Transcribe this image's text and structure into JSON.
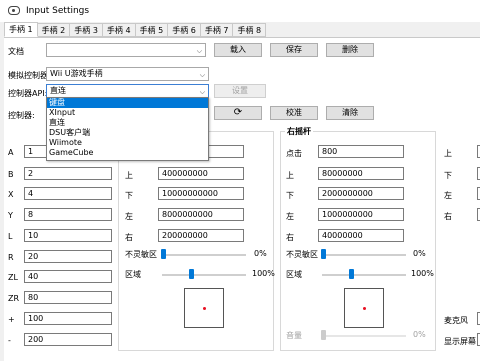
{
  "window": {
    "title": "Input Settings"
  },
  "tabs": [
    "手柄 1",
    "手柄 2",
    "手柄 3",
    "手柄 4",
    "手柄 5",
    "手柄 6",
    "手柄 7",
    "手柄 8"
  ],
  "profile": {
    "label": "文档",
    "value": "",
    "load": "载入",
    "save": "保存",
    "delete": "删除"
  },
  "emulated": {
    "label": "模拟控制器",
    "value": "Wii U游戏手柄"
  },
  "api": {
    "label": "控制器API:",
    "value": "直连",
    "configure": "设置",
    "options": [
      "键盘",
      "XInput",
      "直连",
      "DSU客户端",
      "Wiimote",
      "GameCube"
    ],
    "selected_index": 0
  },
  "controller": {
    "label": "控制器:",
    "calibrate": "校准",
    "clear": "清除"
  },
  "buttons": [
    {
      "label": "A",
      "value": "1"
    },
    {
      "label": "B",
      "value": "2"
    },
    {
      "label": "X",
      "value": "4"
    },
    {
      "label": "Y",
      "value": "8"
    },
    {
      "label": "L",
      "value": "10"
    },
    {
      "label": "R",
      "value": "20"
    },
    {
      "label": "ZL",
      "value": "40"
    },
    {
      "label": "ZR",
      "value": "80"
    },
    {
      "label": "+",
      "value": "100"
    },
    {
      "label": "-",
      "value": "200"
    }
  ],
  "left_stick": {
    "rows": [
      {
        "label": "上",
        "value": "400000000"
      },
      {
        "label": "下",
        "value": "10000000000"
      },
      {
        "label": "左",
        "value": "8000000000"
      },
      {
        "label": "右",
        "value": "200000000"
      }
    ],
    "deadzone_label": "不灵敏区",
    "deadzone_value": "0%",
    "deadzone_level": 0,
    "range_label": "区域",
    "range_value": "100%",
    "range_level": 1
  },
  "right_stick": {
    "title": "右摇杆",
    "rows": [
      {
        "label": "点击",
        "value": "800"
      },
      {
        "label": "上",
        "value": "80000000"
      },
      {
        "label": "下",
        "value": "2000000000"
      },
      {
        "label": "左",
        "value": "1000000000"
      },
      {
        "label": "右",
        "value": "40000000"
      }
    ],
    "deadzone_label": "不灵敏区",
    "deadzone_value": "0%",
    "deadzone_level": 0,
    "range_label": "区域",
    "range_value": "100%",
    "range_level": 1,
    "volume_label": "音量",
    "volume_value": "0%"
  },
  "dpad": {
    "labels": [
      "上",
      "下",
      "左",
      "右"
    ]
  },
  "extra": {
    "mic": "麦克风",
    "show_screen": "显示屏幕"
  }
}
